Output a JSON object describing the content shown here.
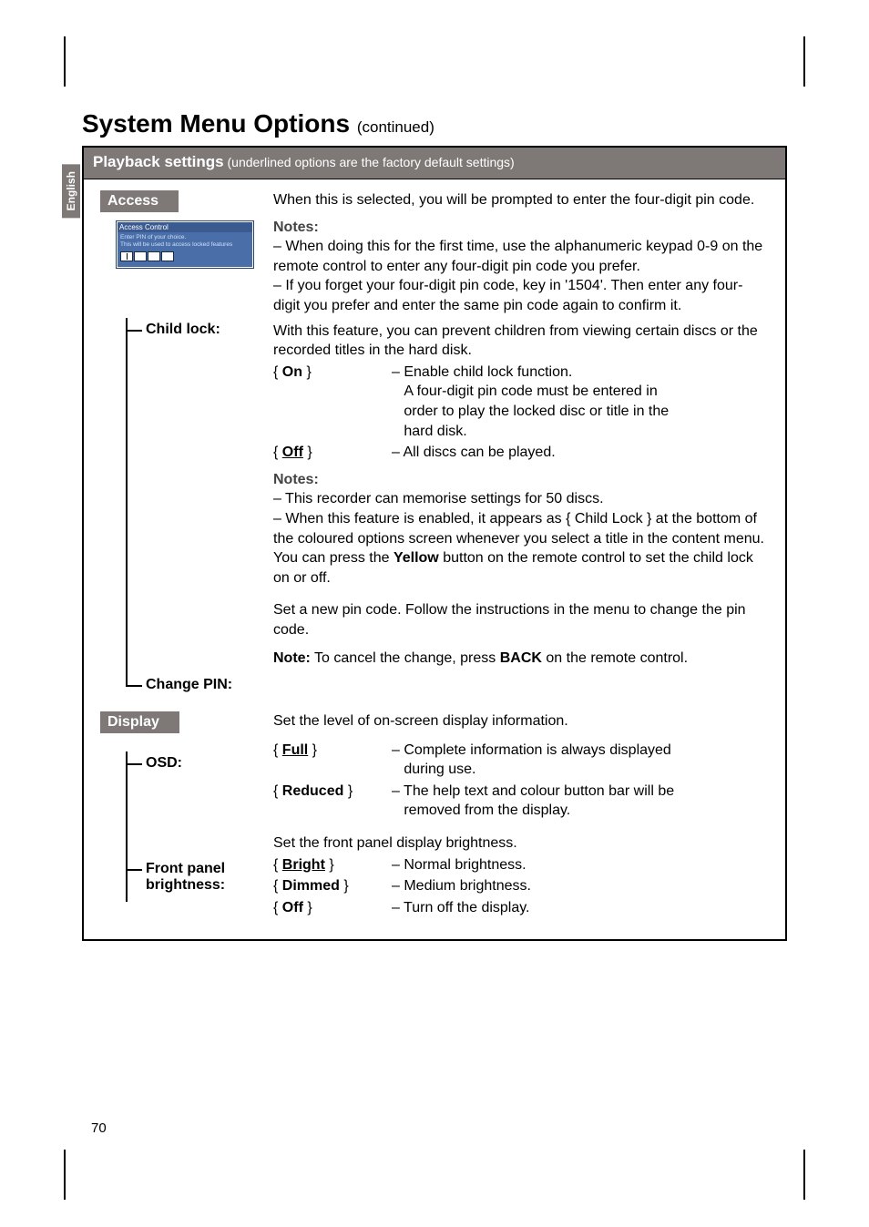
{
  "tab": "English",
  "title_main": "System Menu Options",
  "title_cont": "(continued)",
  "banner_bold": "Playback settings",
  "banner_rest": " (underlined options are the factory default settings)",
  "access": {
    "head": "Access",
    "box_hd": "Access Control",
    "box_l1": "Enter PIN of your choice.",
    "box_l2": "This will be used to access locked features",
    "intro_a": "When this is selected, you will be prompted to enter the four-digit pin code.",
    "notes_label": "Notes:",
    "note1": "–  When doing this for the first time, use the alphanumeric keypad 0-9 on the remote control to enter any four-digit pin code you prefer.",
    "note2": "–  If you forget your four-digit pin code, key in '1504'. Then enter any four-digit you prefer and enter the same pin code again to confirm it."
  },
  "childlock": {
    "label": "Child lock:",
    "intro": "With this feature, you can prevent children from viewing certain discs or the recorded titles in the hard disk.",
    "on_key": "{ On }",
    "on_desc": "– Enable child lock function.\nA four-digit pin code must be entered in order to play the locked disc or title in the hard disk.",
    "off_key": "{ Off }",
    "off_desc": "– All discs can be played.",
    "notes_label": "Notes:",
    "n1": "–  This recorder can memorise settings for 50 discs.",
    "n2": "–  When this feature is enabled, it appears as { Child Lock } at the bottom of the coloured options screen whenever you select a title in the content menu.  You can press the ",
    "n2_yellow": "Yellow",
    "n2b": " button on the remote control to set the child lock on or off."
  },
  "changepin": {
    "label": "Change PIN:",
    "p1": "Set a new pin code.  Follow the instructions in the menu to change the pin code.",
    "p2a": "Note:",
    "p2b": "  To cancel the change, press ",
    "p2c": "BACK",
    "p2d": " on the remote control."
  },
  "display": {
    "head": "Display",
    "intro": "Set the level of on-screen display information."
  },
  "osd": {
    "label": "OSD:",
    "full_key": "{ Full }",
    "full_desc": "– Complete information is always displayed during use.",
    "red_key": "{ Reduced }",
    "red_desc": "– The help text and colour button bar will be removed from the display."
  },
  "fpb": {
    "label1": "Front panel",
    "label2": "brightness:",
    "intro": "Set the front panel display brightness.",
    "bright_key": "{ Bright }",
    "bright_desc": "– Normal brightness.",
    "dim_key": "{ Dimmed }",
    "dim_desc": "– Medium brightness.",
    "off_key": "{ Off }",
    "off_desc": "– Turn off the display."
  },
  "pagenum": "70"
}
